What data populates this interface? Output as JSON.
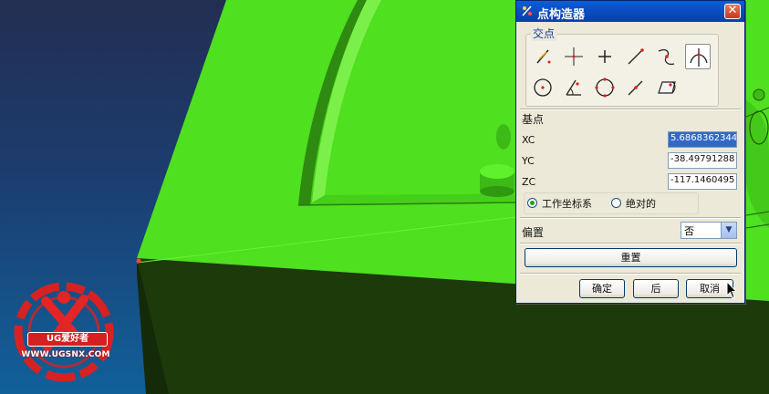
{
  "dialog": {
    "title": "点构造器",
    "close_glyph": "✕",
    "intersection_group": "交点",
    "type_tools": [
      {
        "name": "inferred-point-icon"
      },
      {
        "name": "cursor-location-icon"
      },
      {
        "name": "existing-point-icon"
      },
      {
        "name": "end-point-icon"
      },
      {
        "name": "control-point-icon"
      },
      {
        "name": "intersection-point-icon",
        "selected": true
      },
      {
        "name": "arc-center-icon"
      },
      {
        "name": "angle-on-arc-icon"
      },
      {
        "name": "quadrant-point-icon"
      },
      {
        "name": "point-on-curve-icon"
      },
      {
        "name": "point-on-surface-icon"
      }
    ],
    "base_point_label": "基点",
    "xc_label": "XC",
    "yc_label": "YC",
    "zc_label": "ZC",
    "xc_value": "5.6868362344",
    "yc_value": "-38.49791288",
    "zc_value": "-117.1460495",
    "radio_wcs": "工作坐标系",
    "radio_absolute": "绝对的",
    "offset_label": "偏置",
    "offset_value": "否",
    "reset_label": "重置",
    "ok_label": "确定",
    "back_label": "后",
    "cancel_label": "取消"
  },
  "watermark": {
    "brand": "UG爱好者",
    "url": "WWW.UGSNX.COM"
  },
  "colors": {
    "part_green": "#4fe01f",
    "part_shadow": "#1e3a0c",
    "background_blue": "#1c3d70",
    "titlebar_blue": "#0b4fc4"
  }
}
